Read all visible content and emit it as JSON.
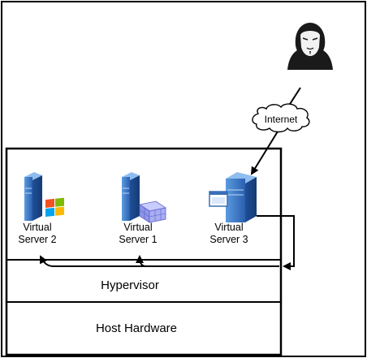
{
  "diagram": {
    "internet_label": "Internet",
    "servers": [
      {
        "line1": "Virtual",
        "line2": "Server 2",
        "os": "windows"
      },
      {
        "line1": "Virtual",
        "line2": "Server 1",
        "os": "database"
      },
      {
        "line1": "Virtual",
        "line2": "Server 3",
        "os": "window"
      }
    ],
    "hypervisor_label": "Hypervisor",
    "hardware_label": "Host Hardware",
    "attacker_icon": "hacker-mask-icon",
    "colors": {
      "server_blue": "#2f6fc0",
      "arrow": "#000000",
      "attacker": "#1a1a1a"
    }
  }
}
